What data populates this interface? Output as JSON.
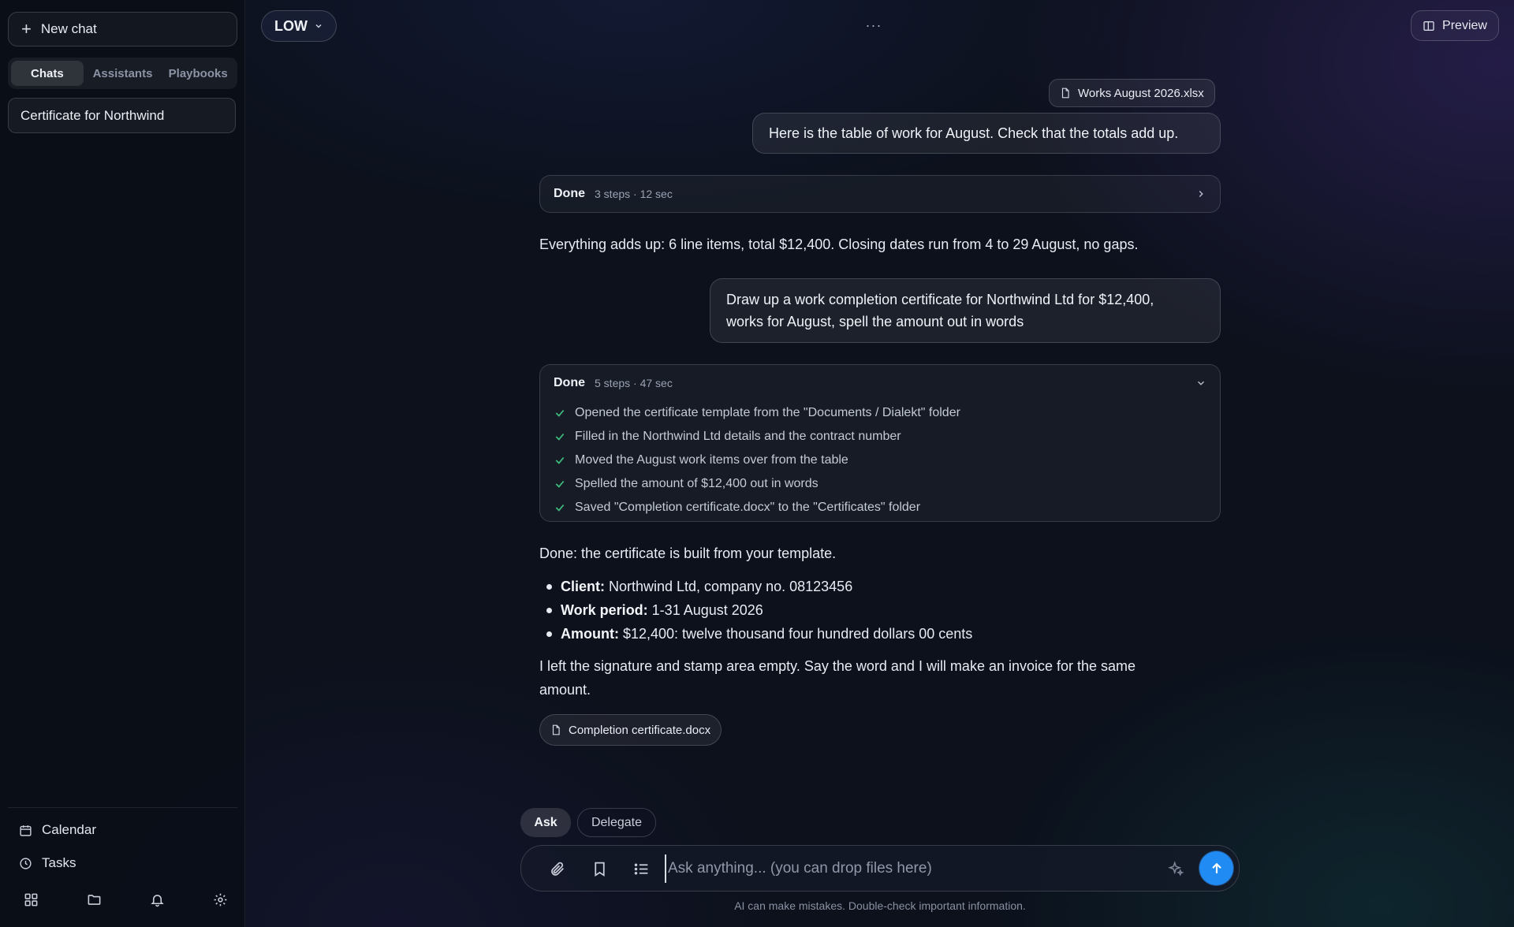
{
  "sidebar": {
    "new_chat_label": "New chat",
    "tabs": [
      {
        "label": "Chats",
        "active": true
      },
      {
        "label": "Assistants",
        "active": false
      },
      {
        "label": "Playbooks",
        "active": false
      }
    ],
    "conversations": [
      {
        "title": "Certificate for Northwind"
      }
    ],
    "links": [
      {
        "label": "Calendar",
        "icon": "calendar-icon"
      },
      {
        "label": "Tasks",
        "icon": "clock-icon"
      }
    ],
    "bottom_icons": [
      "grid-icon",
      "folder-icon",
      "bell-icon",
      "gear-icon"
    ]
  },
  "topbar": {
    "model_label": "LOW",
    "more_label": "···",
    "preview_label": "Preview"
  },
  "chat": {
    "msg1": {
      "attachment": "Works August 2026.xlsx",
      "text": "Here is the table of work for August. Check that the totals add up."
    },
    "steps1": {
      "status": "Done",
      "meta": "3 steps · 12 sec",
      "expanded": false
    },
    "reply1": "Everything adds up: 6 line items, total $12,400. Closing dates run from 4 to 29 August, no gaps.",
    "msg2": {
      "line1": "Draw up a work completion certificate for Northwind Ltd for $12,400,",
      "line2": "works for August, spell the amount out in words"
    },
    "steps2": {
      "status": "Done",
      "meta": "5 steps · 47 sec",
      "expanded": true,
      "items": [
        "Opened the certificate template from the \"Documents / Dialekt\" folder",
        "Filled in the Northwind Ltd details and the contract number",
        "Moved the August work items over from the table",
        "Spelled the amount of $12,400 out in words",
        "Saved \"Completion certificate.docx\" to the \"Certificates\" folder"
      ]
    },
    "reply2": {
      "intro": "Done: the certificate is built from your template.",
      "bullets": [
        {
          "label": "Client:",
          "value": "Northwind Ltd, company no. 08123456"
        },
        {
          "label": "Work period:",
          "value": "1-31 August 2026"
        },
        {
          "label": "Amount:",
          "value": "$12,400: twelve thousand four hundred dollars 00 cents"
        }
      ],
      "outro_line1": "I left the signature and stamp area empty. Say the word and I will make an invoice for the same",
      "outro_line2": "amount.",
      "attachment": "Completion certificate.docx"
    }
  },
  "composer": {
    "modes": [
      {
        "label": "Ask",
        "active": true
      },
      {
        "label": "Delegate",
        "active": false
      }
    ],
    "placeholder": "Ask anything... (you can drop files here)",
    "disclaimer": "AI can make mistakes. Double-check important information."
  },
  "colors": {
    "accent": "#1f8bf3",
    "check": "#3fbf7f"
  }
}
